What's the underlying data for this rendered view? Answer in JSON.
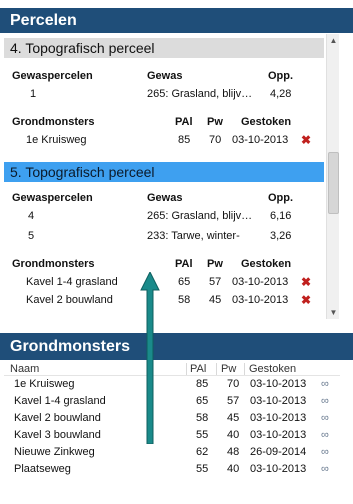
{
  "panels": {
    "percelen_title": "Percelen",
    "grondmonsters_title": "Grondmonsters"
  },
  "perceel4": {
    "title": "4. Topografisch perceel",
    "gewas_headers": {
      "gewaspercelen": "Gewaspercelen",
      "gewas": "Gewas",
      "opp": "Opp."
    },
    "gewas_rows": [
      {
        "nr": "1",
        "gewas": "265: Grasland, blijv…",
        "opp": "4,28"
      }
    ],
    "grond_headers": {
      "grondmonsters": "Grondmonsters",
      "pal": "PAl",
      "pw": "Pw",
      "gestoken": "Gestoken"
    },
    "grond_rows": [
      {
        "naam": "1e Kruisweg",
        "pal": "85",
        "pw": "70",
        "gestoken": "03-10-2013"
      }
    ]
  },
  "perceel5": {
    "title": "5. Topografisch perceel",
    "gewas_headers": {
      "gewaspercelen": "Gewaspercelen",
      "gewas": "Gewas",
      "opp": "Opp."
    },
    "gewas_rows": [
      {
        "nr": "4",
        "gewas": "265: Grasland, blijv…",
        "opp": "6,16"
      },
      {
        "nr": "5",
        "gewas": "233: Tarwe, winter-",
        "opp": "3,26"
      }
    ],
    "grond_headers": {
      "grondmonsters": "Grondmonsters",
      "pal": "PAl",
      "pw": "Pw",
      "gestoken": "Gestoken"
    },
    "grond_rows": [
      {
        "naam": "Kavel 1-4 grasland",
        "pal": "65",
        "pw": "57",
        "gestoken": "03-10-2013"
      },
      {
        "naam": "Kavel 2 bouwland",
        "pal": "58",
        "pw": "45",
        "gestoken": "03-10-2013"
      }
    ]
  },
  "grond_table": {
    "headers": {
      "naam": "Naam",
      "pal": "PAl",
      "pw": "Pw",
      "gestoken": "Gestoken"
    },
    "rows": [
      {
        "naam": "1e Kruisweg",
        "pal": "85",
        "pw": "70",
        "gestoken": "03-10-2013"
      },
      {
        "naam": "Kavel 1-4 grasland",
        "pal": "65",
        "pw": "57",
        "gestoken": "03-10-2013"
      },
      {
        "naam": "Kavel 2 bouwland",
        "pal": "58",
        "pw": "45",
        "gestoken": "03-10-2013"
      },
      {
        "naam": "Kavel 3 bouwland",
        "pal": "55",
        "pw": "40",
        "gestoken": "03-10-2013"
      },
      {
        "naam": "Nieuwe Zinkweg",
        "pal": "62",
        "pw": "48",
        "gestoken": "26-09-2014"
      },
      {
        "naam": "Plaatseweg",
        "pal": "55",
        "pw": "40",
        "gestoken": "03-10-2013"
      }
    ]
  },
  "icons": {
    "delete": "delete-icon",
    "link": "link-icon",
    "arrow": "arrow-up-annotation"
  },
  "colors": {
    "header_bg": "#1f4e79",
    "selected_bg": "#3ea0f0",
    "delete": "#c0201e",
    "arrow": "#1a8a8a"
  }
}
